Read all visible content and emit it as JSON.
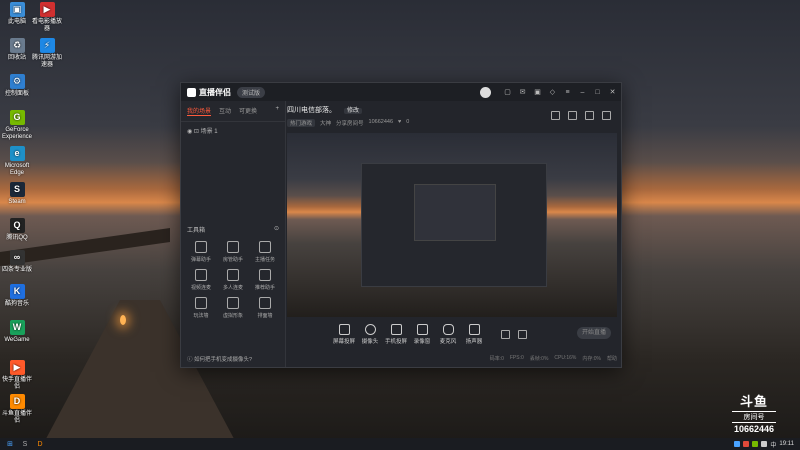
{
  "desktop": {
    "icons_left": [
      "此电脑",
      "回收站",
      "控制面板",
      "GeForce Experience",
      "Microsoft Edge",
      "Steam",
      "腾讯QQ",
      "四条专业版",
      "酷狗音乐",
      "WeGame",
      "快手直播伴侣",
      "斗鱼直播伴侣"
    ],
    "icons_second": [
      "看电影播放器",
      "腾讯网游加速器"
    ]
  },
  "app": {
    "logo_text": "直播伴侣",
    "beta_label": "测试版",
    "left_tabs": [
      "我的场景",
      "互动",
      "可更换"
    ],
    "scene_name": "场景 1",
    "tools_title": "工具箱",
    "tools": [
      "弹幕助手",
      "房管助手",
      "主播任务",
      "视频连麦",
      "多人连麦",
      "推荐助手",
      "玩法墙",
      "虚拟形象",
      "排面墙"
    ],
    "hint": "如何把手机变成摄像头?",
    "room_title": "四川电信部落。",
    "room_action": "修改",
    "room_category": "热门游戏",
    "room_sub": "大神",
    "room_id_label": "分享房间号",
    "room_id": "10662446",
    "room_fans": "0",
    "bottom_tools": [
      "屏幕投屏",
      "摄像头",
      "手机投屏",
      "录像窗",
      "麦克风",
      "扬声器"
    ],
    "go_live": "开始直播",
    "status": [
      "码率:0",
      "FPS:0",
      "丢帧:0%",
      "CPU:16%",
      "内存:0%",
      "帮助"
    ]
  },
  "watermark": {
    "logo": "斗鱼",
    "sub": "房间号",
    "room": "10662446"
  },
  "taskbar": {
    "time": "19:11",
    "lang": "中"
  }
}
